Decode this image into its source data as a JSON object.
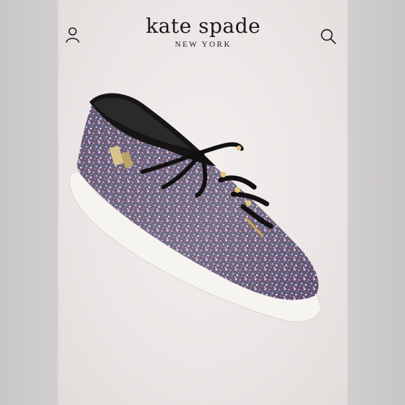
{
  "header": {
    "brand": "kate spade",
    "subbrand": "NEW YORK",
    "icons": [
      "user-icon",
      "search-icon"
    ]
  },
  "product": {
    "image": "glitter-sneaker-image",
    "label_text": "kate spade"
  },
  "colors": {
    "background": "#ebe6e5",
    "text": "#1a1a1a",
    "shoe_outline": "#101010",
    "sole": "#f7f5f3"
  }
}
